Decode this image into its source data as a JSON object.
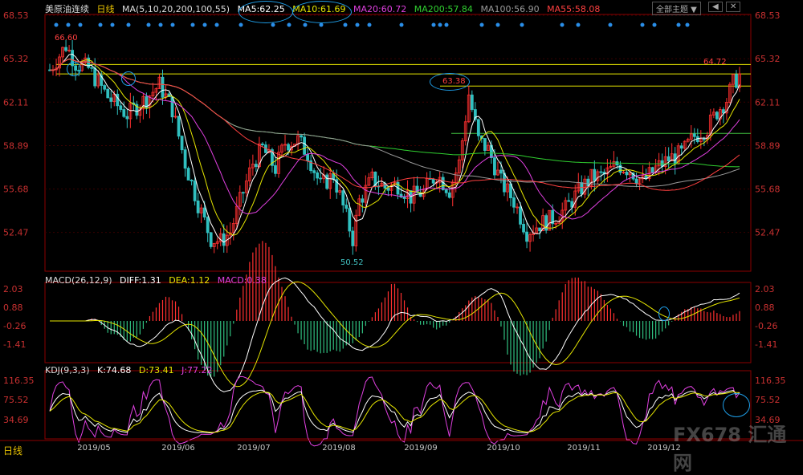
{
  "instrument": "美原油连续",
  "period_label": "日线",
  "main_indicator": {
    "label": "MA(5,10,20,200,100,55)",
    "values": [
      {
        "label": "MA5:62.25",
        "color": "#ffffff"
      },
      {
        "label": "MA10:61.69",
        "color": "#e6e600"
      },
      {
        "label": "MA20:60.72",
        "color": "#e040e0"
      },
      {
        "label": "MA200:57.84",
        "color": "#30d030"
      },
      {
        "label": "MA100:56.90",
        "color": "#9a9a9a"
      },
      {
        "label": "MA55:58.08",
        "color": "#ff4040"
      }
    ]
  },
  "toolbar": {
    "theme_label": "全部主题 ▼",
    "prev_label": "◀",
    "next_label": "✕"
  },
  "macd": {
    "label": "MACD(26,12,9)",
    "values": [
      {
        "label": "DIFF:1.31",
        "color": "#ffffff"
      },
      {
        "label": "DEA:1.12",
        "color": "#e6e600"
      },
      {
        "label": "MACD:0.38",
        "color": "#e040e0"
      }
    ],
    "ticks": [
      "2.03",
      "0.88",
      "-0.26",
      "-1.41"
    ]
  },
  "kdj": {
    "label": "KDJ(9,3,3)",
    "values": [
      {
        "label": "K:74.68",
        "color": "#ffffff"
      },
      {
        "label": "D:73.41",
        "color": "#e6e600"
      },
      {
        "label": "J:77.22",
        "color": "#e040e0"
      }
    ],
    "ticks": [
      "116.35",
      "75.52",
      "34.69"
    ]
  },
  "watermark": "FX678 汇通网",
  "chart_data": {
    "type": "candlestick",
    "y_ticks": [
      "68.53",
      "65.32",
      "62.11",
      "58.89",
      "55.68",
      "52.47"
    ],
    "ylim": [
      49.6,
      68.6
    ],
    "x_ticks": [
      "2019/05",
      "2019/06",
      "2019/07",
      "2019/08",
      "2019/09",
      "2019/10",
      "2019/11",
      "2019/12"
    ],
    "annotations": [
      "66.60",
      "50.52",
      "63.38",
      "64.72"
    ],
    "horizontal_levels": [
      64.9,
      64.2,
      63.3,
      59.8
    ],
    "price_path": [
      [
        0,
        64.5
      ],
      [
        5,
        66.3
      ],
      [
        8,
        65.0
      ],
      [
        12,
        64.6
      ],
      [
        18,
        62.5
      ],
      [
        24,
        61.2
      ],
      [
        30,
        62.4
      ],
      [
        34,
        63.4
      ],
      [
        38,
        61.6
      ],
      [
        42,
        57.6
      ],
      [
        46,
        54.6
      ],
      [
        50,
        52.0
      ],
      [
        53,
        51.8
      ],
      [
        56,
        52.5
      ],
      [
        60,
        55.5
      ],
      [
        63,
        57.6
      ],
      [
        66,
        58.7
      ],
      [
        70,
        57.2
      ],
      [
        73,
        59.1
      ],
      [
        77,
        59.3
      ],
      [
        80,
        58.3
      ],
      [
        84,
        55.9
      ],
      [
        88,
        56.7
      ],
      [
        92,
        53.6
      ],
      [
        94,
        52.0
      ],
      [
        96,
        54.8
      ],
      [
        100,
        56.4
      ],
      [
        104,
        55.8
      ],
      [
        108,
        56.0
      ],
      [
        112,
        55.1
      ],
      [
        116,
        55.5
      ],
      [
        120,
        56.8
      ],
      [
        124,
        55.6
      ],
      [
        127,
        57.6
      ],
      [
        130,
        62.7
      ],
      [
        133,
        59.3
      ],
      [
        136,
        58.6
      ],
      [
        140,
        56.2
      ],
      [
        144,
        54.8
      ],
      [
        148,
        52.5
      ],
      [
        152,
        53.1
      ],
      [
        156,
        53.5
      ],
      [
        160,
        54.2
      ],
      [
        164,
        55.5
      ],
      [
        168,
        56.5
      ],
      [
        172,
        56.7
      ],
      [
        176,
        57.5
      ],
      [
        180,
        57.1
      ],
      [
        184,
        56.2
      ],
      [
        188,
        57.2
      ],
      [
        192,
        57.9
      ],
      [
        196,
        58.3
      ],
      [
        200,
        59.6
      ],
      [
        204,
        60.2
      ],
      [
        207,
        61.4
      ],
      [
        210,
        62.3
      ],
      [
        212,
        63.5
      ],
      [
        214,
        64.1
      ]
    ]
  }
}
